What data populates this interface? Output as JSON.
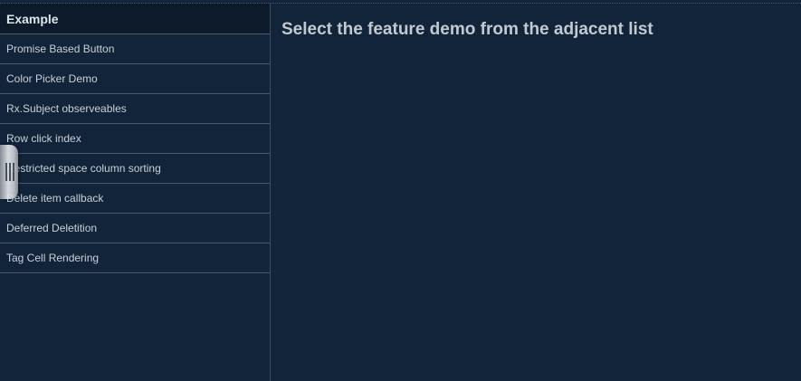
{
  "sidebar": {
    "header": "Example",
    "items": [
      {
        "label": "Promise Based Button"
      },
      {
        "label": "Color Picker Demo"
      },
      {
        "label": "Rx.Subject observeables"
      },
      {
        "label": "Row click index"
      },
      {
        "label": "Restricted space column sorting"
      },
      {
        "label": "Delete item callback"
      },
      {
        "label": "Deferred Deletition"
      },
      {
        "label": "Tag Cell Rendering"
      }
    ]
  },
  "main": {
    "title": "Select the feature demo from the adjacent list"
  },
  "colors": {
    "background": "#11243a",
    "header_background": "#0d1a2a",
    "divider": "#4a5a6c",
    "text": "#c8d0d8"
  },
  "icons": [
    "drag-handle-icon"
  ]
}
